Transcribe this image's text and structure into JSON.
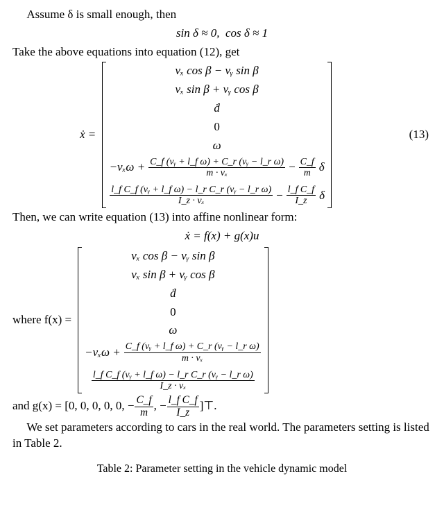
{
  "text": {
    "assume_line": "Assume δ is small enough, then",
    "small_angle": "sin δ ≈ 0,  cos δ ≈ 1",
    "take_above": "Take the above equations into equation (12), get",
    "then_affine": "Then, we can write equation (13) into affine nonlinear form:",
    "affine_eq": "ẋ = f(x) + g(x)u",
    "where_prefix": "where f(x) =",
    "and_line_pre": "and g(x) = [0, 0, 0, 0, 0, −",
    "and_line_mid": ", −",
    "and_line_post": "]⊤.",
    "params_line": "We set parameters according to cars in the real world. The parameters setting is listed in Table 2.",
    "caption": "Table 2: Parameter setting in the vehicle dynamic model"
  },
  "eq13": {
    "prefix": "ẋ =",
    "rows": {
      "r1": "vₓ cos β − vᵧ sin β",
      "r2": "vₓ sin β + vᵧ cos β",
      "r3": "ḋ",
      "r4": "0",
      "r5": "ω",
      "r6_pre": "−vₓω + ",
      "r6_mid": " − ",
      "r6_post": "δ",
      "r7_mid": " − ",
      "r7_post": "δ"
    },
    "num": "(13)"
  },
  "fx": {
    "r1": "vₓ cos β − vᵧ sin β",
    "r2": "vₓ sin β + vᵧ cos β",
    "r3": "ḋ",
    "r4": "0",
    "r5": "ω",
    "r6_pre": "−vₓω + "
  },
  "frac": {
    "A_num": "C_f (vᵧ + l_f ω) + C_r (vᵧ − l_r ω)",
    "A_den": "m · vₓ",
    "B_num": "C_f",
    "B_den": "m",
    "C_num": "l_f C_f (vᵧ + l_f ω) − l_r C_r (vᵧ − l_r ω)",
    "C_den": "I_z · vₓ",
    "D_num": "l_f C_f",
    "D_den": "I_z",
    "g1_num": "C_f",
    "g1_den": "m",
    "g2_num": "l_f C_f",
    "g2_den": "I_z"
  }
}
